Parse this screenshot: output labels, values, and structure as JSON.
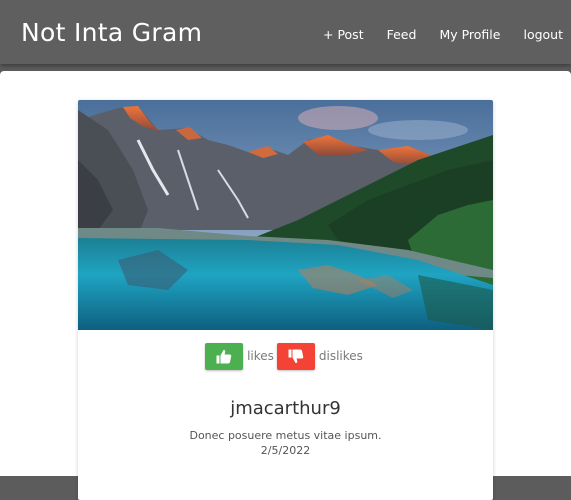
{
  "navbar": {
    "brand": "Not Inta Gram",
    "links": [
      "+ Post",
      "Feed",
      "My Profile",
      "logout"
    ]
  },
  "post": {
    "image": "mountain-lake-photo",
    "likes_label": "likes",
    "dislikes_label": "dislikes",
    "username": "jmacarthur9",
    "caption": "Donec posuere metus vitae ipsum.",
    "date": "2/5/2022"
  },
  "colors": {
    "navbar": "#5f5f5f",
    "like": "#4caf50",
    "dislike": "#f44336"
  }
}
